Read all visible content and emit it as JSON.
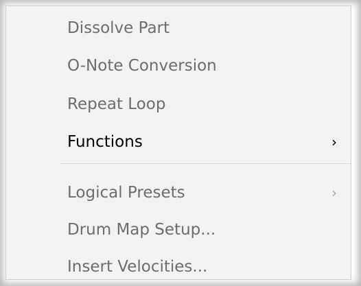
{
  "menu": {
    "items": [
      {
        "label": "Dissolve Part",
        "enabled": false
      },
      {
        "label": "O-Note Conversion",
        "enabled": false
      },
      {
        "label": "Repeat Loop",
        "enabled": false
      },
      {
        "label": "Functions",
        "enabled": true,
        "submenu_icon": "chevron-right-icon",
        "chevron": "›"
      },
      {
        "label": "Logical Presets",
        "enabled": false,
        "submenu_icon": "chevron-right-icon",
        "chevron": "›"
      },
      {
        "label": "Drum Map Setup...",
        "enabled": false
      },
      {
        "label": "Insert Velocities...",
        "enabled": false
      }
    ]
  }
}
